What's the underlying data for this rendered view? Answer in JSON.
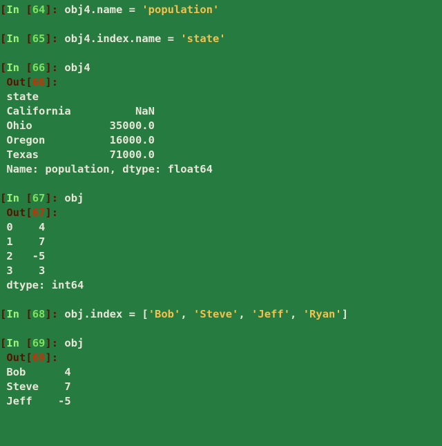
{
  "cells": [
    {
      "kind": "in",
      "n": "64",
      "code_before": "obj4.name = ",
      "code_str": "'population'",
      "code_after": ""
    },
    {
      "kind": "gap"
    },
    {
      "kind": "in",
      "n": "65",
      "code_before": "obj4.index.name = ",
      "code_str": "'state'",
      "code_after": ""
    },
    {
      "kind": "gap"
    },
    {
      "kind": "in",
      "n": "66",
      "code_before": "obj4",
      "code_str": "",
      "code_after": ""
    },
    {
      "kind": "out",
      "n": "66"
    },
    {
      "kind": "txt",
      "text": "state"
    },
    {
      "kind": "txt",
      "text": "California          NaN"
    },
    {
      "kind": "txt",
      "text": "Ohio            35000.0"
    },
    {
      "kind": "txt",
      "text": "Oregon          16000.0"
    },
    {
      "kind": "txt",
      "text": "Texas           71000.0"
    },
    {
      "kind": "txt",
      "text": "Name: population, dtype: float64"
    },
    {
      "kind": "gap"
    },
    {
      "kind": "in",
      "n": "67",
      "code_before": "obj",
      "code_str": "",
      "code_after": ""
    },
    {
      "kind": "out",
      "n": "67"
    },
    {
      "kind": "txt",
      "text": "0    4"
    },
    {
      "kind": "txt",
      "text": "1    7"
    },
    {
      "kind": "txt",
      "text": "2   -5"
    },
    {
      "kind": "txt",
      "text": "3    3"
    },
    {
      "kind": "txt",
      "text": "dtype: int64"
    },
    {
      "kind": "gap"
    },
    {
      "kind": "in",
      "n": "68",
      "code_before": "obj.index = [",
      "code_str": "'Bob', 'Steve', 'Jeff', 'Ryan'",
      "code_after": "]",
      "mixed": true
    },
    {
      "kind": "gap"
    },
    {
      "kind": "in",
      "n": "69",
      "code_before": "obj",
      "code_str": "",
      "code_after": ""
    },
    {
      "kind": "out",
      "n": "69"
    },
    {
      "kind": "txt",
      "text": "Bob      4"
    },
    {
      "kind": "txt",
      "text": "Steve    7"
    },
    {
      "kind": "txt",
      "text": "Jeff    -5"
    }
  ],
  "labels": {
    "in": "In ",
    "out": "Out"
  },
  "mixed68": {
    "pre": "obj.index = [",
    "s1": "'Bob'",
    "c1": ", ",
    "s2": "'Steve'",
    "c2": ", ",
    "s3": "'Jeff'",
    "c3": ", ",
    "s4": "'Ryan'",
    "post": "]"
  }
}
